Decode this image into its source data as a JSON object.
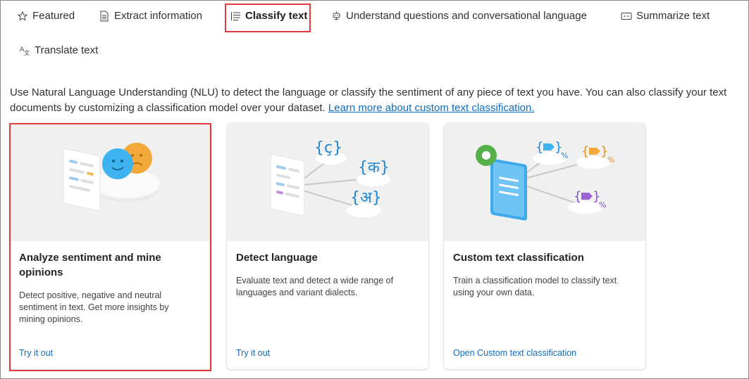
{
  "tabs": [
    {
      "label": "Featured",
      "icon": "star-icon"
    },
    {
      "label": "Extract information",
      "icon": "document-icon"
    },
    {
      "label": "Classify text",
      "icon": "list-icon",
      "active": true
    },
    {
      "label": "Understand questions and conversational language",
      "icon": "bot-icon"
    },
    {
      "label": "Summarize text",
      "icon": "summary-icon"
    },
    {
      "label": "Translate text",
      "icon": "translate-icon"
    }
  ],
  "intro": {
    "text": "Use Natural Language Understanding (NLU) to detect the language or classify the sentiment of any piece of text you have. You can also classify your text documents by customizing a classification model over your dataset.",
    "link": "Learn more about custom text classification."
  },
  "cards": [
    {
      "title": "Analyze sentiment and mine opinions",
      "description": "Detect positive, negative and neutral sentiment in text. Get more insights by mining opinions.",
      "link": "Try it out",
      "illustration": "sentiment-faces-illustration"
    },
    {
      "title": "Detect language",
      "description": "Evaluate text and detect a wide range of languages and variant dialects.",
      "link": "Try it out",
      "illustration": "language-bubbles-illustration",
      "glyphs": [
        "{ç}",
        "{क}",
        "{अ}"
      ]
    },
    {
      "title": "Custom text classification",
      "description": "Train a classification model to classify text using your own data.",
      "link": "Open Custom text classification",
      "illustration": "custom-classification-illustration",
      "percent_sign": "%"
    }
  ],
  "colors": {
    "highlight": "#e03a3e",
    "link": "#0f6cbd",
    "art_background": "#f0f0f0"
  }
}
